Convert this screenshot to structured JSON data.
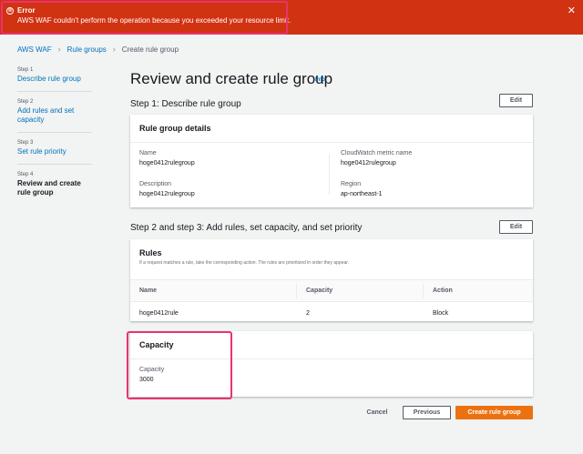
{
  "error": {
    "title": "Error",
    "message": "AWS WAF couldn't perform the operation because you exceeded your resource limit.",
    "close": "✕",
    "icon": "⊗"
  },
  "breadcrumb": {
    "items": [
      "AWS WAF",
      "Rule groups",
      "Create rule group"
    ],
    "separator": "›"
  },
  "steps": [
    {
      "num": "Step 1",
      "label": "Describe rule group"
    },
    {
      "num": "Step 2",
      "label": "Add rules and set capacity"
    },
    {
      "num": "Step 3",
      "label": "Set rule priority"
    },
    {
      "num": "Step 4",
      "label": "Review and create rule group"
    }
  ],
  "page": {
    "title": "Review and create rule group",
    "info": "Info"
  },
  "step1": {
    "title": "Step 1: Describe rule group",
    "edit": "Edit",
    "panel_title": "Rule group details",
    "name_label": "Name",
    "name_value": "hoge0412rulegroup",
    "description_label": "Description",
    "description_value": "hoge0412rulegroup",
    "metric_label": "CloudWatch metric name",
    "metric_value": "hoge0412rulegroup",
    "region_label": "Region",
    "region_value": "ap-northeast-1"
  },
  "step23": {
    "title": "Step 2 and step 3: Add rules, set capacity, and set priority",
    "edit": "Edit",
    "rules_title": "Rules",
    "rules_desc": "If a request matches a rule, take the corresponding action. The rules are prioritized in order they appear.",
    "columns": [
      "Name",
      "Capacity",
      "Action"
    ],
    "rows": [
      {
        "name": "hoge0412rule",
        "capacity": "2",
        "action": "Block"
      }
    ]
  },
  "capacity": {
    "panel_title": "Capacity",
    "label": "Capacity",
    "value": "3000"
  },
  "footer": {
    "cancel": "Cancel",
    "previous": "Previous",
    "create": "Create rule group"
  },
  "colors": {
    "error_bg": "#d13212",
    "link": "#0073bb",
    "primary": "#ec7211",
    "highlight": "#e8336e"
  }
}
